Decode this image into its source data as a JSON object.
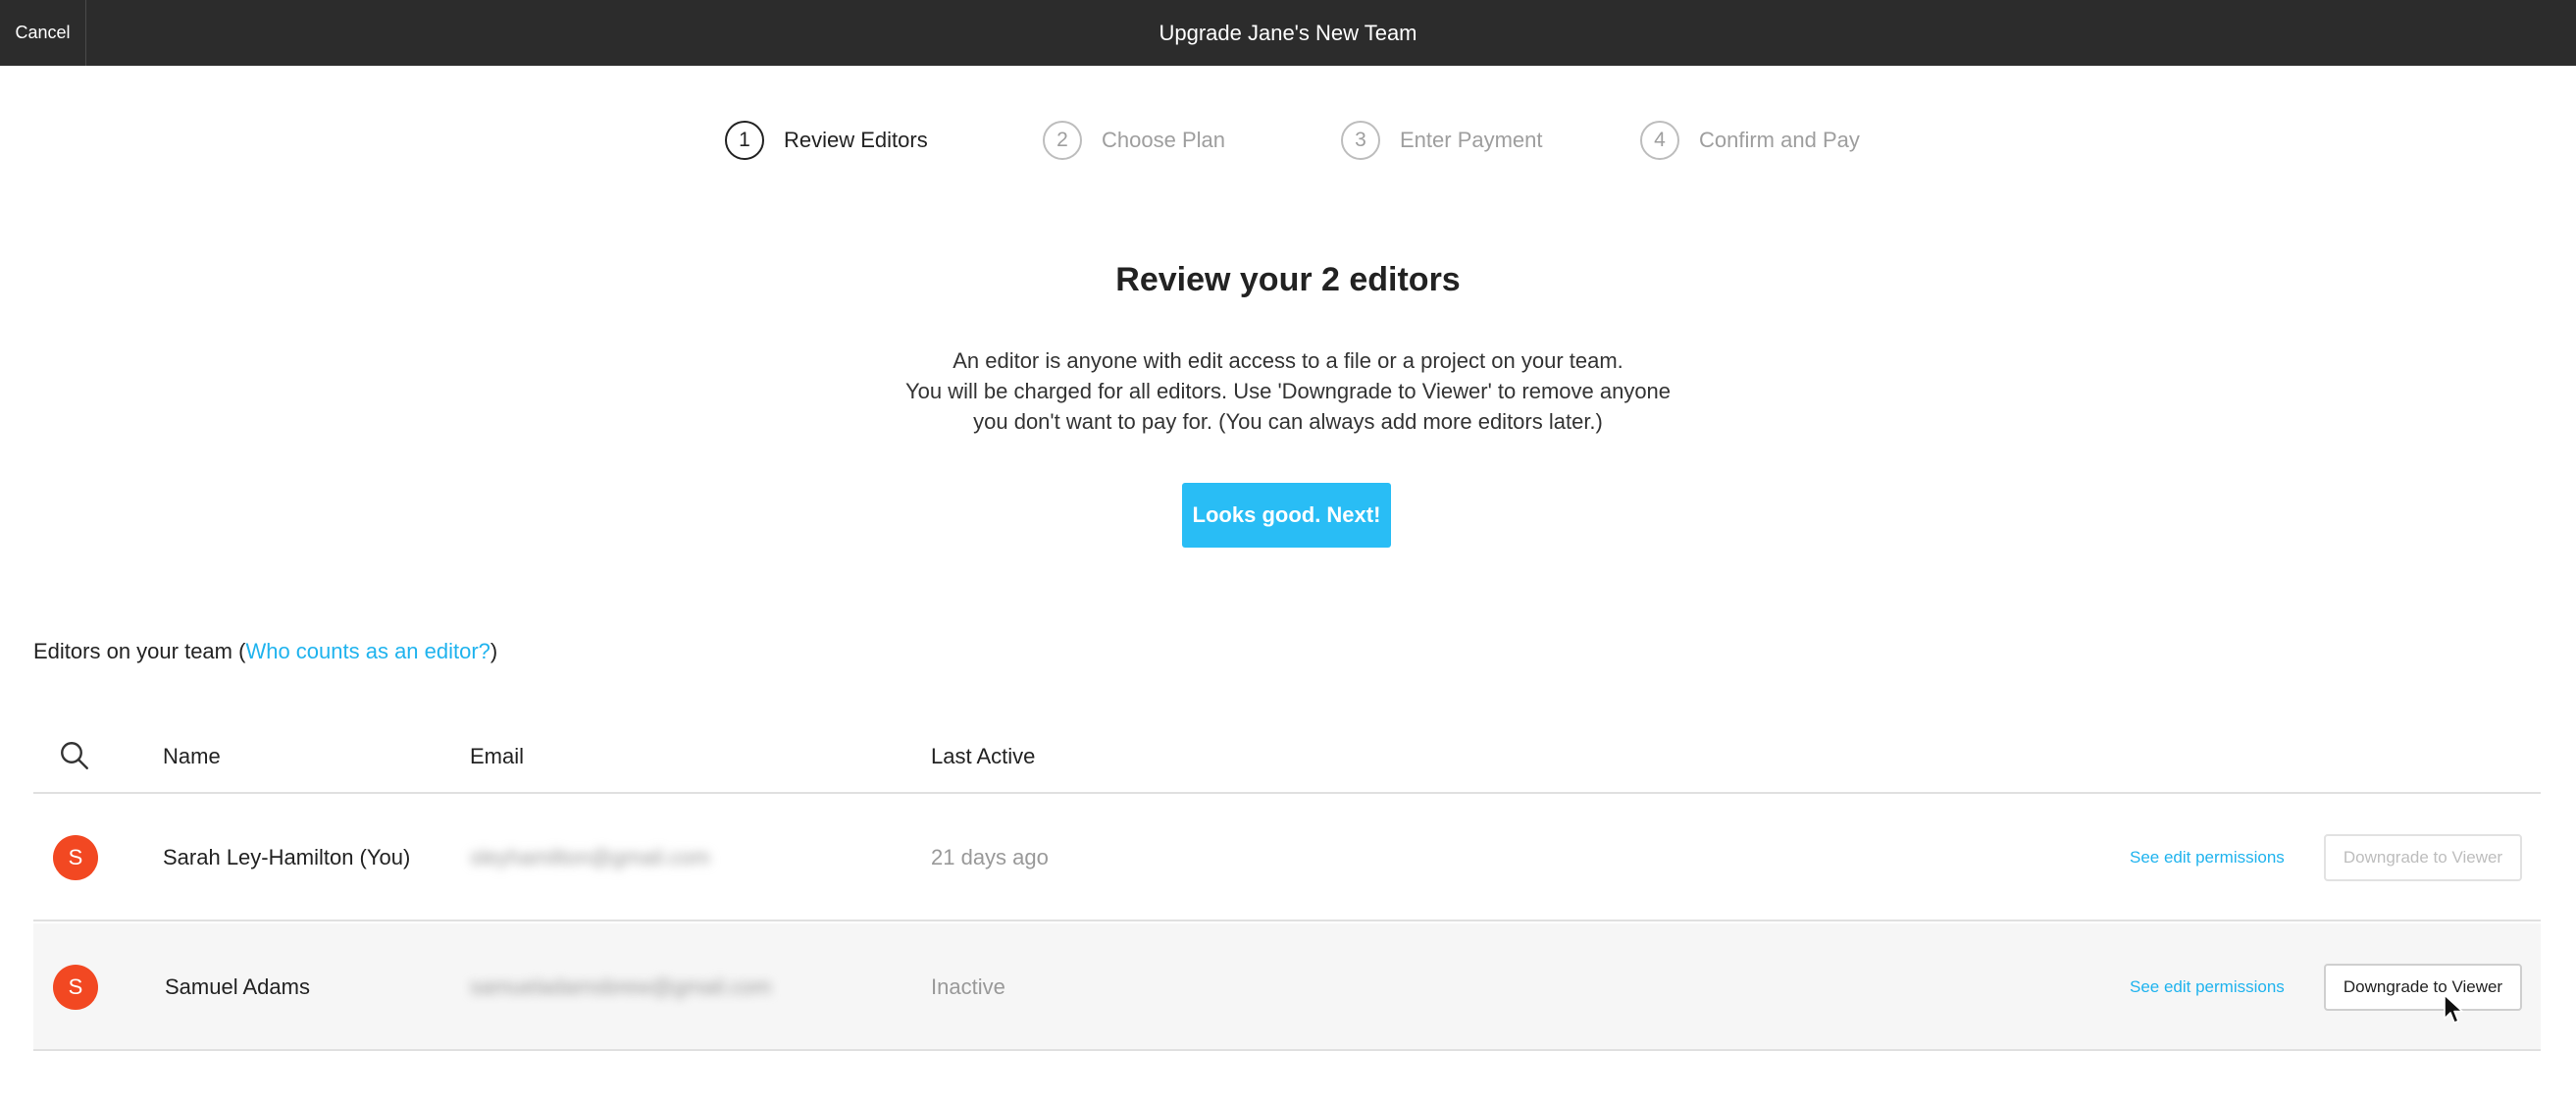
{
  "topbar": {
    "cancel_label": "Cancel",
    "title": "Upgrade Jane's New Team"
  },
  "stepper": [
    {
      "number": "1",
      "label": "Review Editors",
      "active": true
    },
    {
      "number": "2",
      "label": "Choose Plan",
      "active": false
    },
    {
      "number": "3",
      "label": "Enter Payment",
      "active": false
    },
    {
      "number": "4",
      "label": "Confirm and Pay",
      "active": false
    }
  ],
  "main": {
    "heading": "Review your 2 editors",
    "description_lines": [
      "An editor is anyone with edit access to a file or a project on your team.",
      "You will be charged for all editors. Use 'Downgrade to Viewer' to remove anyone",
      "you don't want to pay for. (You can always add more editors later.)"
    ],
    "next_button": "Looks good. Next!"
  },
  "editors": {
    "title_prefix": "Editors on your team (",
    "title_link": "Who counts as an editor?",
    "title_suffix": ")",
    "columns": [
      "Name",
      "Email",
      "Last Active"
    ],
    "rows": [
      {
        "avatar_initial": "S",
        "name": "Sarah Ley-Hamilton (You)",
        "email": "sleyhamilton@gmail.com",
        "last_active": "21 days ago",
        "permissions_link": "See edit permissions",
        "action": "Downgrade to Viewer",
        "action_enabled": false
      },
      {
        "avatar_initial": "S",
        "name": "Samuel Adams",
        "email": "samueladamsbrew@gmail.com",
        "last_active": "Inactive",
        "permissions_link": "See edit permissions",
        "action": "Downgrade to Viewer",
        "action_enabled": true
      }
    ]
  },
  "colors": {
    "topbar_bg": "#2c2c2c",
    "primary": "#29bdf5",
    "link": "#1fb3ee",
    "avatar": "#f24822"
  },
  "icons": [
    "search-icon",
    "cursor-icon"
  ]
}
